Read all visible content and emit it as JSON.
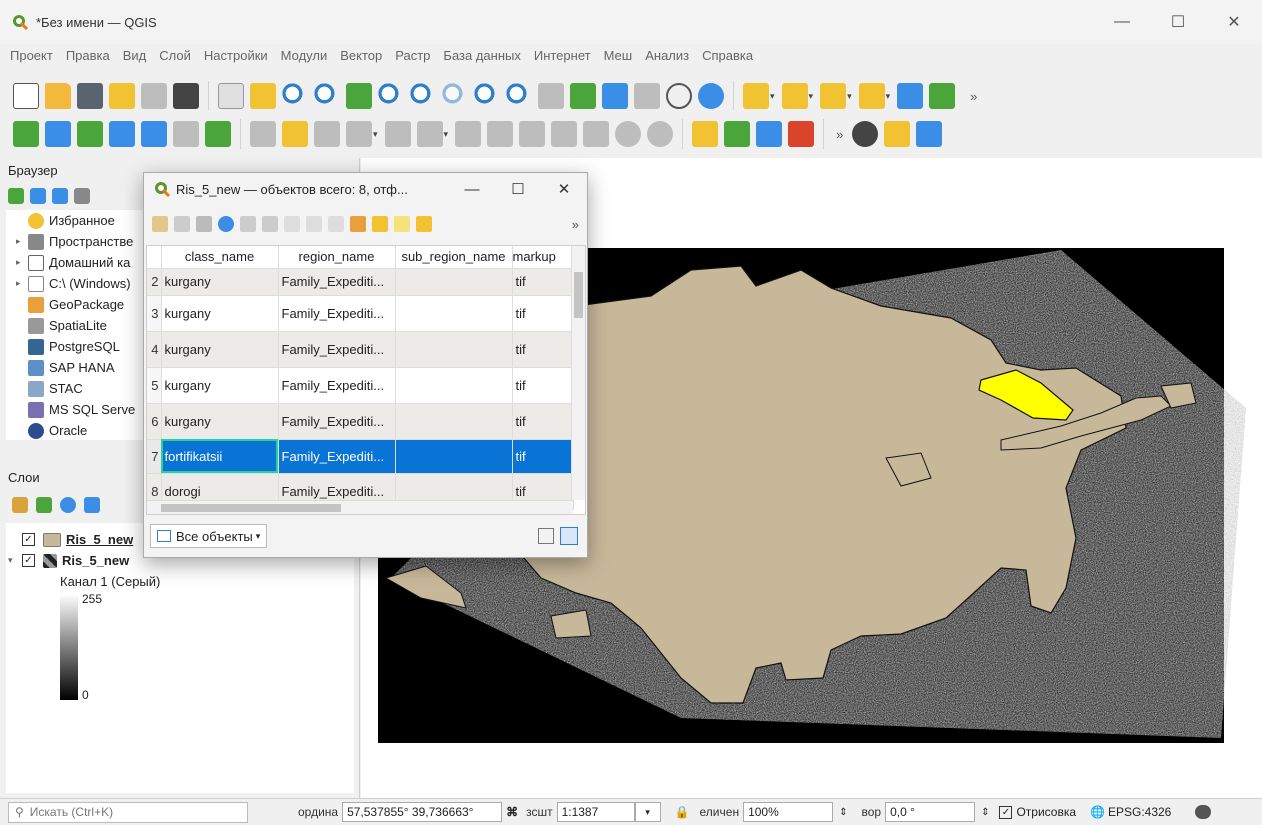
{
  "window": {
    "title": "*Без имени — QGIS",
    "minimize": "—",
    "maximize": "☐",
    "close": "✕"
  },
  "menu": [
    "Проект",
    "Правка",
    "Вид",
    "Слой",
    "Настройки",
    "Модули",
    "Вектор",
    "Растр",
    "База данных",
    "Интернет",
    "Меш",
    "Анализ",
    "Справка"
  ],
  "toolbar_more": "»",
  "browser": {
    "title": "Браузер",
    "items": [
      {
        "label": "Избранное",
        "icon": "star-icon",
        "arrow": ""
      },
      {
        "label": "Пространстве",
        "icon": "spatial-bookmarks-icon",
        "arrow": "▸"
      },
      {
        "label": "Домашний ка",
        "icon": "home-icon",
        "arrow": "▸"
      },
      {
        "label": "C:\\ (Windows)",
        "icon": "drive-icon",
        "arrow": "▸"
      },
      {
        "label": "GeoPackage",
        "icon": "geopackage-icon",
        "arrow": ""
      },
      {
        "label": "SpatiaLite",
        "icon": "spatialite-icon",
        "arrow": ""
      },
      {
        "label": "PostgreSQL",
        "icon": "postgresql-icon",
        "arrow": ""
      },
      {
        "label": "SAP HANA",
        "icon": "sap-hana-icon",
        "arrow": ""
      },
      {
        "label": "STAC",
        "icon": "stac-icon",
        "arrow": ""
      },
      {
        "label": "MS SQL Serve",
        "icon": "mssql-icon",
        "arrow": ""
      },
      {
        "label": "Oracle",
        "icon": "oracle-icon",
        "arrow": ""
      }
    ]
  },
  "layers": {
    "title": "Слои",
    "items": [
      {
        "label": "Ris_5_new",
        "checked": "✓",
        "swatch": "#c8b89a"
      },
      {
        "label": "Ris_5_new",
        "checked": "✓",
        "swatch": "raster"
      }
    ],
    "band": "Канал 1 (Серый)",
    "max": "255",
    "min": "0"
  },
  "attr_table": {
    "title": "Ris_5_new — объектов всего: 8, отф...",
    "columns": [
      "class_name",
      "region_name",
      "sub_region_name",
      "markup"
    ],
    "rows": [
      {
        "n": "2",
        "class_name": "kurgany",
        "region_name": "Family_Expediti...",
        "sub_region_name": "",
        "markup": "tif"
      },
      {
        "n": "3",
        "class_name": "kurgany",
        "region_name": "Family_Expediti...",
        "sub_region_name": "",
        "markup": "tif"
      },
      {
        "n": "4",
        "class_name": "kurgany",
        "region_name": "Family_Expediti...",
        "sub_region_name": "",
        "markup": "tif"
      },
      {
        "n": "5",
        "class_name": "kurgany",
        "region_name": "Family_Expediti...",
        "sub_region_name": "",
        "markup": "tif"
      },
      {
        "n": "6",
        "class_name": "kurgany",
        "region_name": "Family_Expediti...",
        "sub_region_name": "",
        "markup": "tif"
      },
      {
        "n": "7",
        "class_name": "fortifikatsii",
        "region_name": "Family_Expediti...",
        "sub_region_name": "",
        "markup": "tif"
      },
      {
        "n": "8",
        "class_name": "dorogi",
        "region_name": "Family_Expediti...",
        "sub_region_name": "",
        "markup": "tif"
      }
    ],
    "filter_button": "Все объекты",
    "more": "»"
  },
  "status": {
    "search_placeholder": "Искать (Ctrl+K)",
    "coord_label": "ордина",
    "coord_value": "57,537855° 39,736663°",
    "scale_label": "зсшт",
    "scale_value": "1:1387",
    "magnifier_label": "еличен",
    "magnifier_value": "100%",
    "rotation_label": "вор",
    "rotation_value": "0,0 °",
    "render_label": "Отрисовка",
    "render_checked": "✓",
    "crs": "EPSG:4326"
  },
  "colors": {
    "polygon": "#c8b89a",
    "highlight": "#ffff00",
    "selection": "#0a74d6",
    "focus": "#27d39a"
  }
}
